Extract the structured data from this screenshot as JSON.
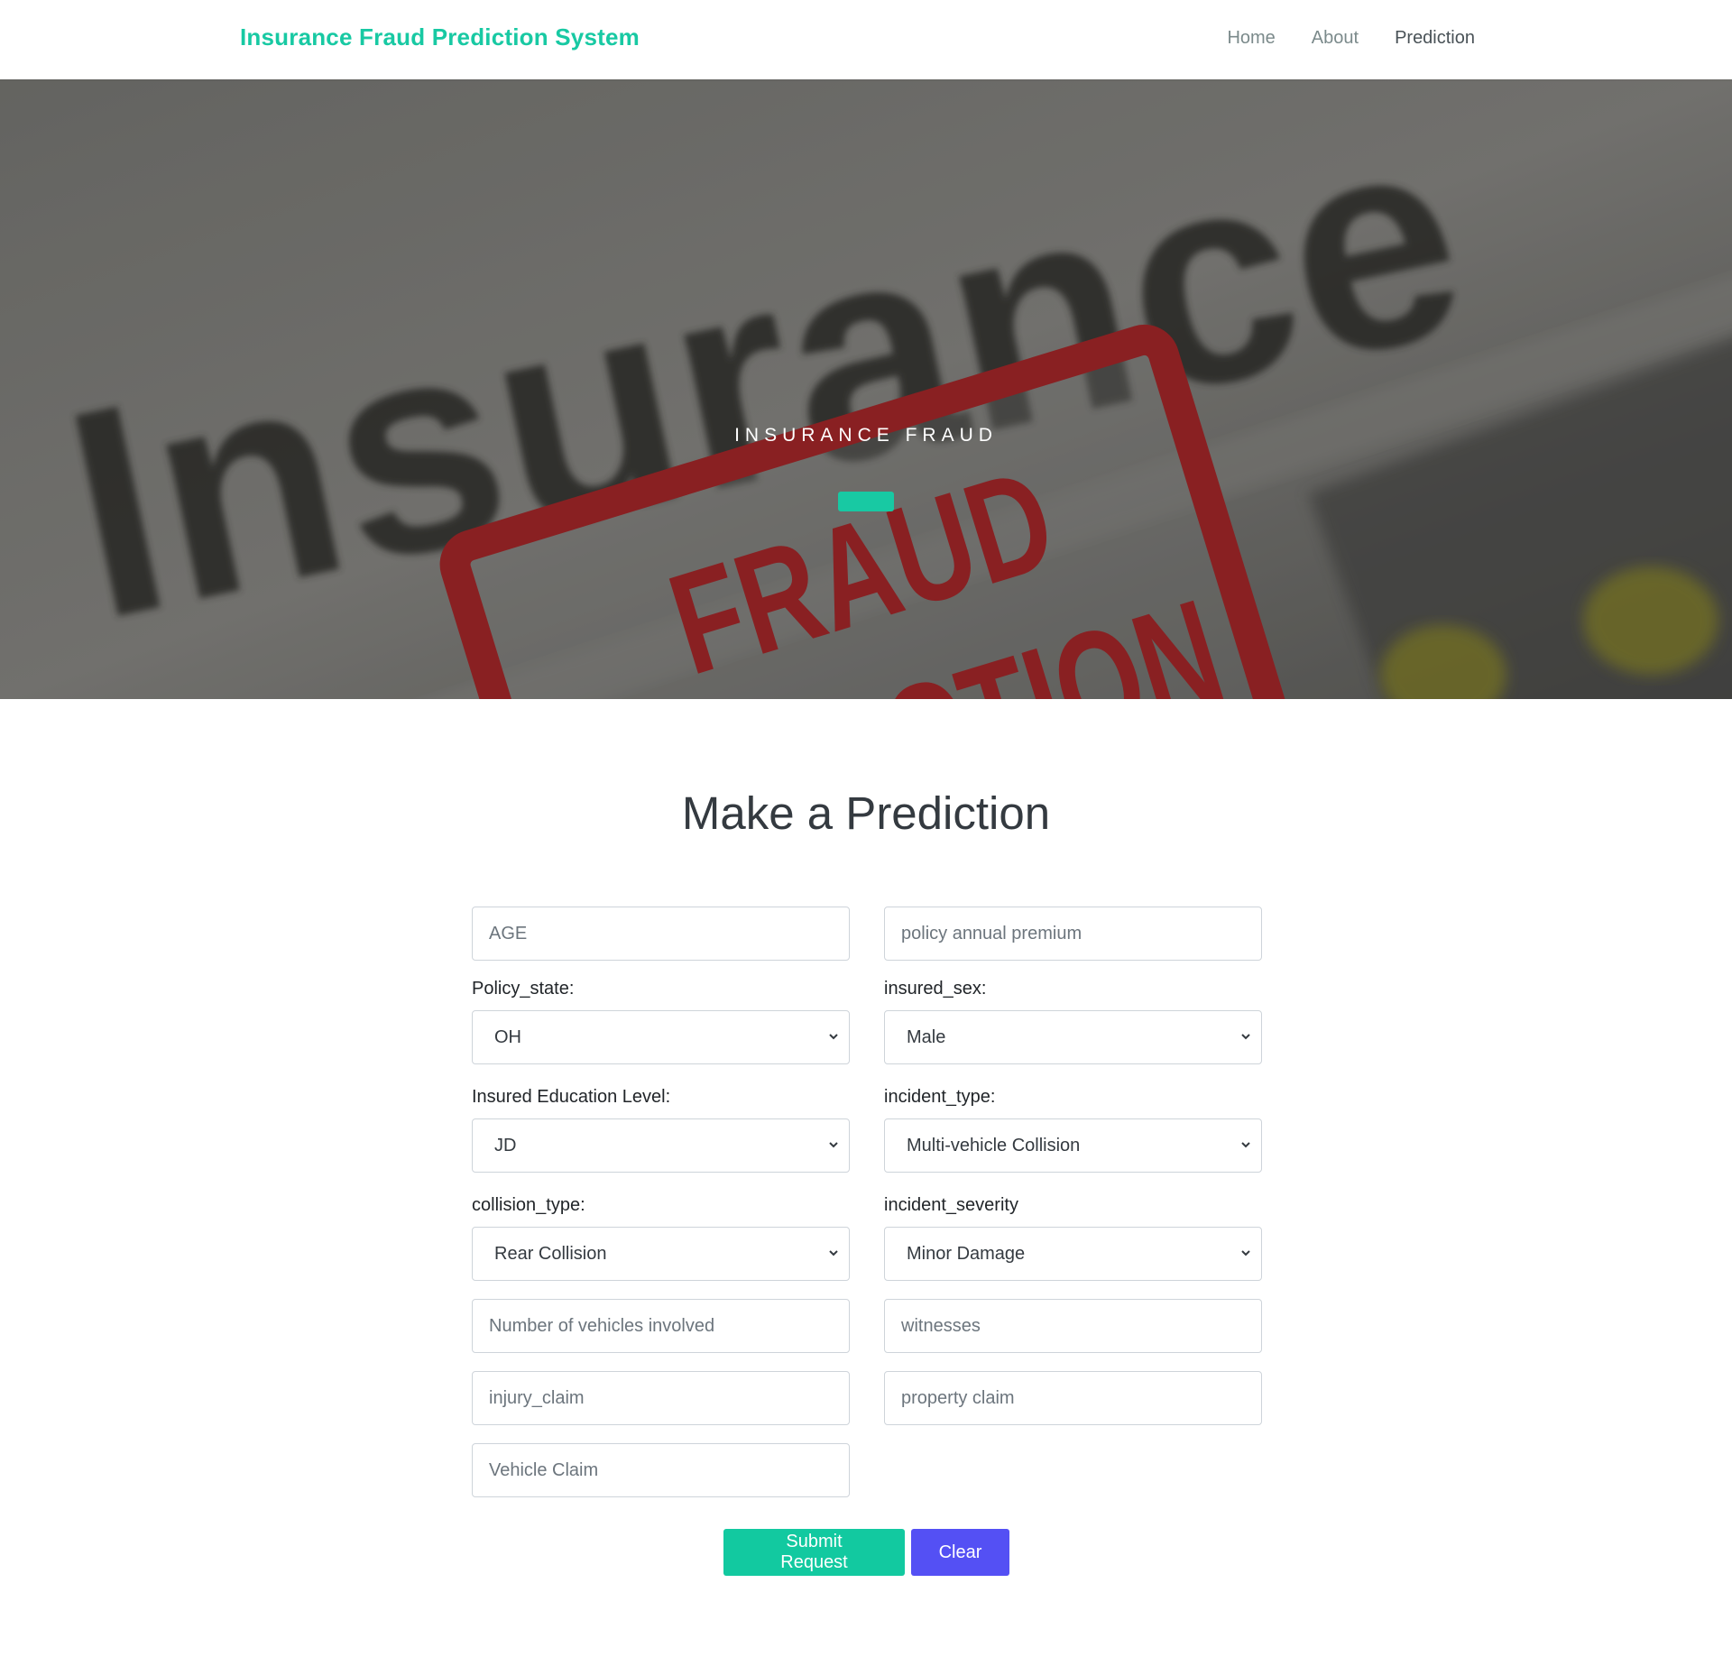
{
  "navbar": {
    "brand": "Insurance Fraud Prediction System",
    "links": [
      {
        "label": "Home"
      },
      {
        "label": "About"
      },
      {
        "label": "Prediction"
      }
    ]
  },
  "hero": {
    "title": "INSURANCE FRAUD",
    "image": {
      "background_word": "Insurance",
      "stamp_line1": "FRAUD",
      "stamp_line2": "DETECTION"
    }
  },
  "form": {
    "title": "Make a Prediction",
    "age_placeholder": "AGE",
    "premium_placeholder": "policy annual premium",
    "policy_state": {
      "label": "Policy_state:",
      "value": "OH"
    },
    "insured_sex": {
      "label": "insured_sex:",
      "value": "Male"
    },
    "education": {
      "label": "Insured Education Level:",
      "value": "JD"
    },
    "incident_type": {
      "label": "incident_type:",
      "value": "Multi-vehicle Collision"
    },
    "collision_type": {
      "label": "collision_type:",
      "value": "Rear Collision"
    },
    "incident_severity": {
      "label": "incident_severity",
      "value": "Minor Damage"
    },
    "vehicles_placeholder": "Number of vehicles involved",
    "witnesses_placeholder": "witnesses",
    "injury_placeholder": "injury_claim",
    "property_placeholder": "property claim",
    "vehicle_claim_placeholder": "Vehicle Claim",
    "submit_label": "Submit Request",
    "clear_label": "Clear"
  },
  "colors": {
    "accent": "#18c9a3",
    "submit": "#12c9a0",
    "clear": "#5450f4",
    "stamp_red": "#a8282a"
  }
}
